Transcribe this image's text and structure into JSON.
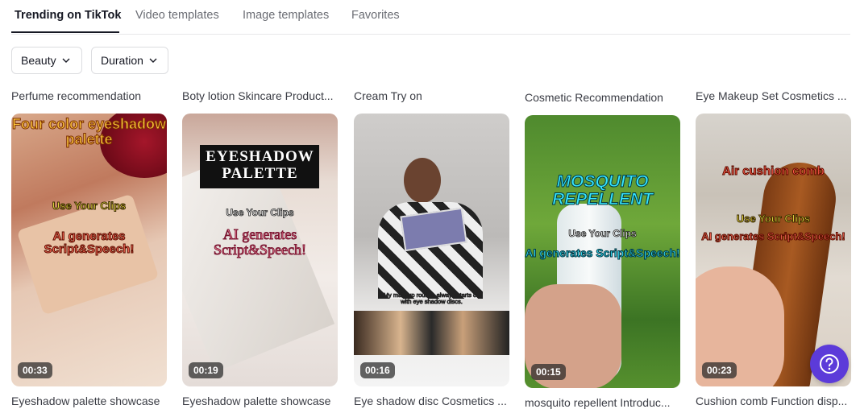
{
  "tabs": [
    {
      "label": "Trending on TikTok",
      "active": true
    },
    {
      "label": "Video templates",
      "active": false
    },
    {
      "label": "Image templates",
      "active": false
    },
    {
      "label": "Favorites",
      "active": false
    }
  ],
  "filters": [
    {
      "label": "Beauty",
      "icon": "chevron-down-icon"
    },
    {
      "label": "Duration",
      "icon": "chevron-down-icon"
    }
  ],
  "cards": [
    {
      "title": "Perfume recommendation",
      "duration": "00:33",
      "overlay": {
        "headline": "Four color eyeshadow palette",
        "line1": "Use Your Clips",
        "line2": "AI generates Script&Speech!"
      },
      "caption": "Eyeshadow palette showcase"
    },
    {
      "title": "Boty lotion Skincare Product...",
      "duration": "00:19",
      "overlay": {
        "headline": "EYESHADOW PALETTE",
        "line1": "Use Your Clips",
        "line2": "AI generates Script&Speech!"
      },
      "caption": "Eyeshadow palette showcase"
    },
    {
      "title": "Cream Try on",
      "duration": "00:16",
      "overlay": {
        "subtitle": "My makeup routine always starts off with eye shadow discs."
      },
      "caption": "Eye shadow disc Cosmetics ..."
    },
    {
      "title": "Cosmetic Recommendation",
      "duration": "00:15",
      "overlay": {
        "headline": "MOSQUITO REPELLENT",
        "line1": "Use Your Clips",
        "line2": "AI generates Script&Speech!"
      },
      "caption": "mosquito repellent Introduc..."
    },
    {
      "title": "Eye Makeup Set Cosmetics ...",
      "duration": "00:23",
      "overlay": {
        "headline": "Air cushion comb",
        "line1": "Use Your Clips",
        "line2": "AI generates Script&Speech!"
      },
      "caption": "Cushion comb Function disp..."
    }
  ],
  "help_button": {
    "icon": "question-mark-icon",
    "color": "#5c3bd9"
  }
}
